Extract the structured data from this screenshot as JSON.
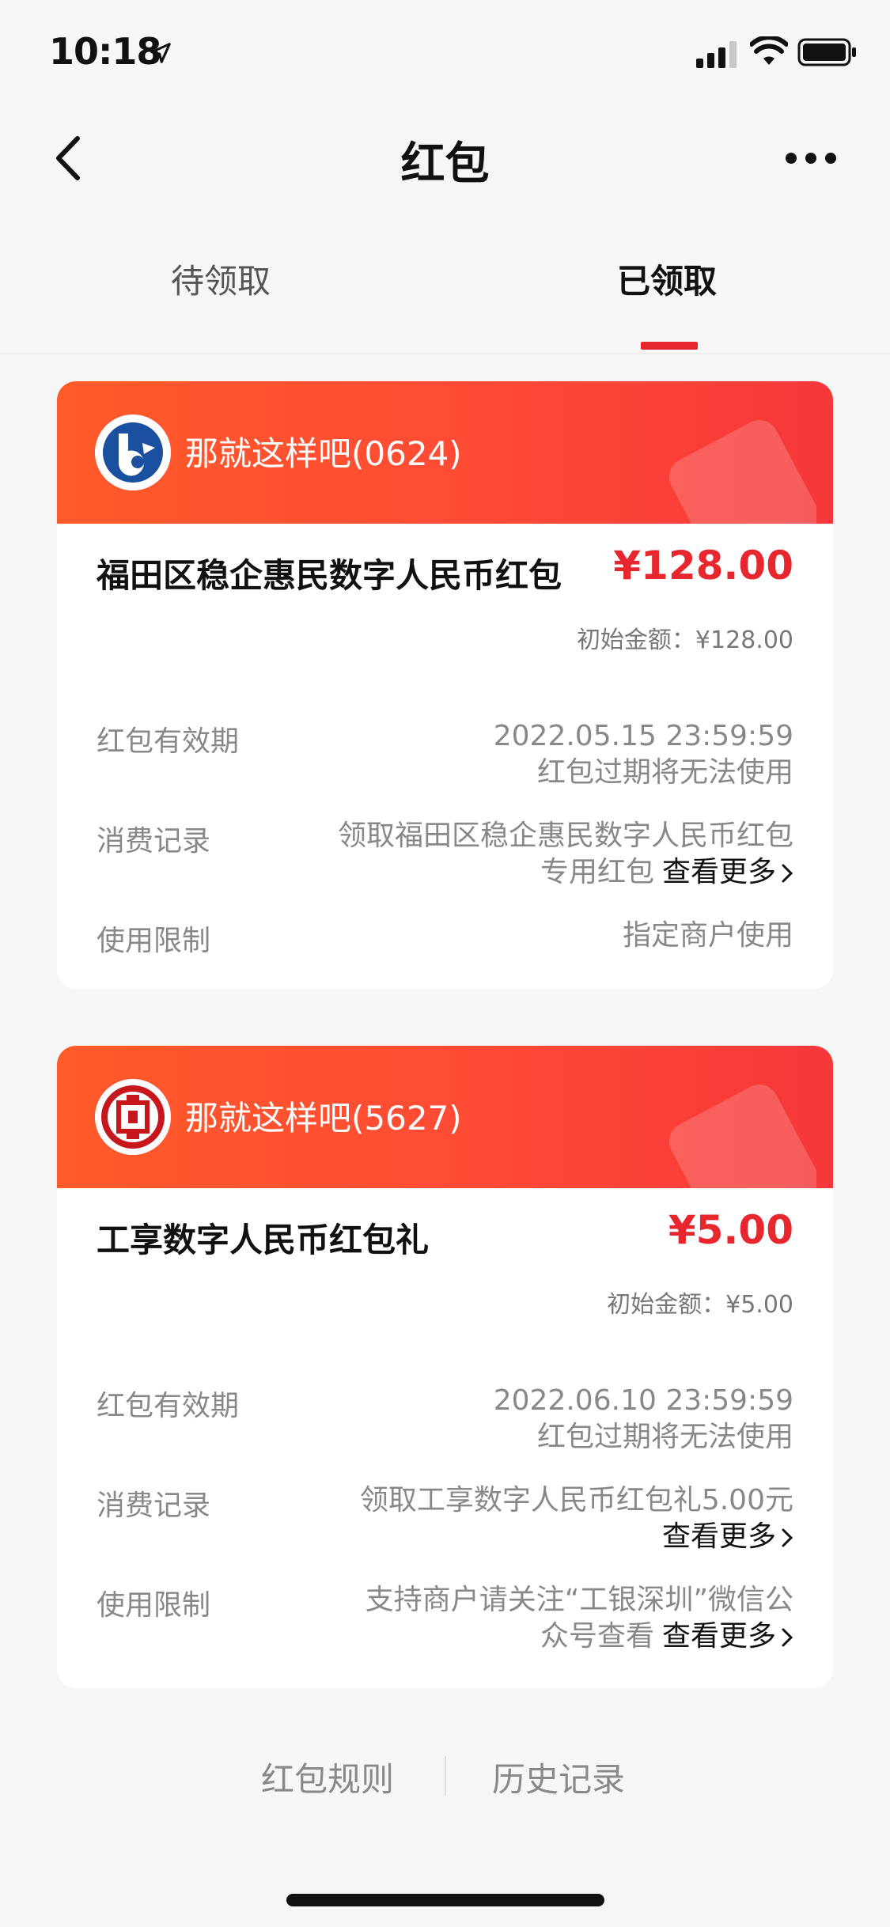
{
  "status_bar": {
    "time": "10:18"
  },
  "nav": {
    "title": "红包"
  },
  "tabs": [
    {
      "label": "待领取",
      "active": false
    },
    {
      "label": "已领取",
      "active": true
    }
  ],
  "cards": [
    {
      "nickname": "那就这样吧(0624)",
      "title": "福田区稳企惠民数字人民币红包",
      "amount": "¥128.00",
      "initial": "初始金额：¥128.00",
      "validity_label": "红包有效期",
      "validity_value": "2022.05.15 23:59:59",
      "validity_note": "红包过期将无法使用",
      "record_label": "消费记录",
      "record_line1": "领取福田区稳企惠民数字人民币红包",
      "record_line2": "专用红包",
      "record_more": "查看更多",
      "limit_label": "使用限制",
      "limit_line1": "指定商户使用"
    },
    {
      "nickname": "那就这样吧(5627)",
      "title": "工享数字人民币红包礼",
      "amount": "¥5.00",
      "initial": "初始金额：¥5.00",
      "validity_label": "红包有效期",
      "validity_value": "2022.06.10 23:59:59",
      "validity_note": "红包过期将无法使用",
      "record_label": "消费记录",
      "record_line1": "领取工享数字人民币红包礼5.00元",
      "record_more": "查看更多",
      "limit_label": "使用限制",
      "limit_line1": "支持商户请关注“工银深圳”微信公",
      "limit_line2": "众号查看",
      "limit_more": "查看更多"
    }
  ],
  "footer": {
    "rules": "红包规则",
    "history": "历史记录"
  },
  "colors": {
    "accent": "#e8262d",
    "header_start": "#ff5a2a",
    "header_end": "#f5373a"
  },
  "icons": [
    "location-arrow-icon",
    "signal-icon",
    "wifi-icon",
    "battery-icon",
    "back-arrow-icon",
    "more-dots-icon",
    "cmb-bank-logo",
    "icbc-bank-logo",
    "red-envelope-decoration",
    "chevron-right-icon"
  ]
}
